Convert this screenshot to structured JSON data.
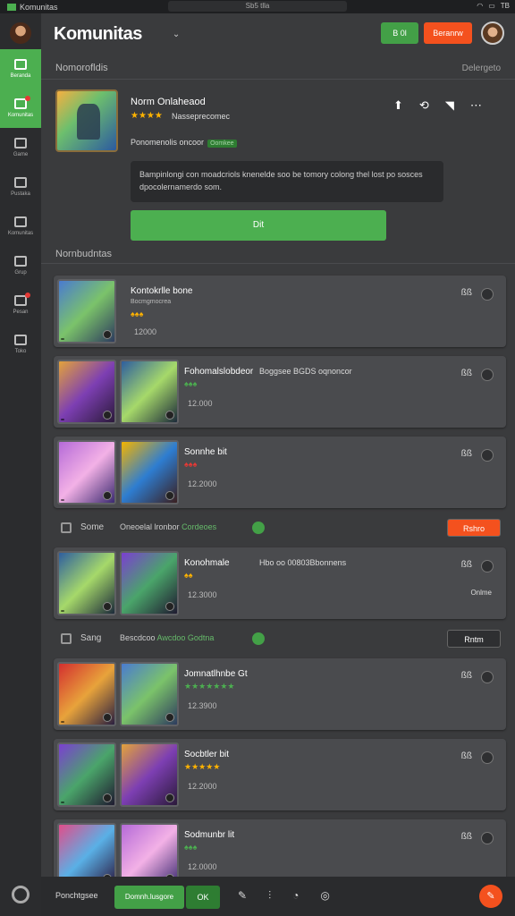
{
  "topbar": {
    "app_title": "Komunitas",
    "center_text": "Sb5 tlla",
    "right_icons": [
      "wifi-icon",
      "battery-icon"
    ],
    "right_text": "TB"
  },
  "header": {
    "title": "Komunitas",
    "subtitle": "",
    "btn_green": "B 0l",
    "btn_orange": "Beranrw"
  },
  "sidebar": {
    "items": [
      {
        "label": "Beranda",
        "icon": "home-icon",
        "active": true
      },
      {
        "label": "Komunitas",
        "icon": "chat-icon",
        "active": true,
        "alert": true
      },
      {
        "label": "Game",
        "icon": "grid-icon"
      },
      {
        "label": "Pustaka",
        "icon": "book-icon"
      },
      {
        "label": "Komunitas",
        "icon": "mail-icon"
      },
      {
        "label": "Grup",
        "icon": "group-icon"
      },
      {
        "label": "Pesan",
        "icon": "gear-icon",
        "alert": true
      },
      {
        "label": "Toko",
        "icon": "store-icon"
      }
    ]
  },
  "sections": {
    "top_label": "Nomorofldis",
    "top_right": "Delergeto",
    "mid_label": "Nornbudntas"
  },
  "feature": {
    "title": "Norm Onlaheaod",
    "stars": "★★★★",
    "rating_text": "Nasseprecomec",
    "line": "Ponomenolis oncoor",
    "tag": "Oomkee",
    "description": "Bampinlongi con moadcriols knenelde soo be tomory colong thel lost po sosces dpocolernamerdo som.",
    "play_label": "Dit"
  },
  "cards": [
    {
      "kind": "single",
      "title": "Kontokrlle bone",
      "tags": "Bocmgmocrea",
      "stars": "♠♠♠",
      "num": "12000",
      "side": "ßß"
    },
    {
      "kind": "double",
      "title": "Fohomalslobdeor",
      "extra": "Boggsee BGDS oqnoncor",
      "stars": "♠♠♠",
      "num": "12.000",
      "side": "ßß"
    },
    {
      "kind": "double",
      "title": "Sonnhe bit",
      "stars": "♠♠♠",
      "num": "12.2000",
      "side": "ßß"
    },
    {
      "kind": "banner",
      "label": "Some",
      "text": "Oneoelal lronbor",
      "highlight": "Cordeoes",
      "btn": "Rshro",
      "btn_color": "#f4511e"
    },
    {
      "kind": "double",
      "title": "Konohmale",
      "extra": "Hbo oo 00803Bbonnens",
      "stars": "♠♠",
      "num": "12.3000",
      "side": "ßß",
      "side_btn": "Onlme"
    },
    {
      "kind": "banner",
      "label": "Sang",
      "text": "Bescdcoo",
      "highlight": "Awcdoo Godtna",
      "btn": "Rntm",
      "btn_color": "#2e2f31"
    },
    {
      "kind": "double",
      "title": "Jomnatlhnbe Gt",
      "stars": "★★★★★★★",
      "num": "12.3900",
      "side": "ßß"
    },
    {
      "kind": "double",
      "title": "Socbtler bit",
      "stars": "★★★★★",
      "num": "12.2000",
      "side": "ßß"
    },
    {
      "kind": "double",
      "title": "Sodmunbr lit",
      "stars": "♠♠♠",
      "num": "12.0000",
      "side": "ßß"
    }
  ],
  "bottombar": {
    "label": "Ponchtgsee",
    "input": "Domnh.lusgore",
    "ok": "OK",
    "icons": [
      "pencil-icon",
      "chart-icon",
      "bell-icon",
      "chat-bubble-icon"
    ]
  },
  "colors": {
    "accent": "#4caf50",
    "warning": "#f4511e",
    "bg": "#3a3b3d",
    "card": "#4a4b4e"
  }
}
